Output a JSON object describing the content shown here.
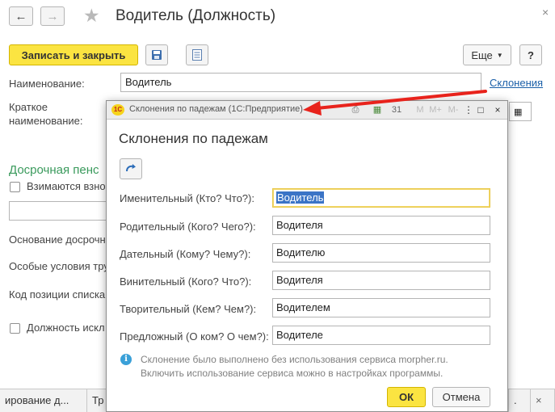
{
  "main": {
    "title": "Водитель (Должность)",
    "save_close_label": "Записать и закрыть",
    "more_label": "Еще",
    "help_label": "?",
    "close_symbol": "×",
    "name_label": "Наименование:",
    "name_value": "Водитель",
    "declensions_link": "Склонения",
    "short_name_label_1": "Краткое",
    "short_name_label_2": "наименование:",
    "early_pension_section": "Досрочная пенс",
    "contributions_label": "Взимаются взно",
    "early_basis_label": "Основание досрочн",
    "special_conditions_label": "Особые условия тру",
    "position_code_label": "Код позиции списка",
    "excluded_label": "Должность искл"
  },
  "bottom_tabs": [
    "ирование д...",
    "Тр",
    "."
  ],
  "dialog": {
    "caption": "Склонения по падежам  (1С:Предприятие)",
    "logo_text": "1С",
    "heading": "Склонения по падежам",
    "cases": [
      {
        "label": "Именительный (Кто? Что?):",
        "value": "Водитель"
      },
      {
        "label": "Родительный (Кого? Чего?):",
        "value": "Водителя"
      },
      {
        "label": "Дательный (Кому? Чему?):",
        "value": "Водителю"
      },
      {
        "label": "Винительный (Кого? Что?):",
        "value": "Водителя"
      },
      {
        "label": "Творительный (Кем? Чем?):",
        "value": "Водителем"
      },
      {
        "label": "Предложный (О ком? О чем?):",
        "value": "Водителе"
      }
    ],
    "info_line_1": "Склонение было выполнено без использования сервиса morpher.ru.",
    "info_line_2": "Включить использование сервиса можно в настройках программы.",
    "ok_label": "ОК",
    "cancel_label": "Отмена",
    "mem_labels": [
      "M",
      "M+",
      "M-"
    ]
  },
  "colors": {
    "accent_yellow": "#fbe441",
    "link_blue": "#1a5fa8",
    "section_green": "#3a9a5c",
    "arrow_red": "#e8231c"
  }
}
